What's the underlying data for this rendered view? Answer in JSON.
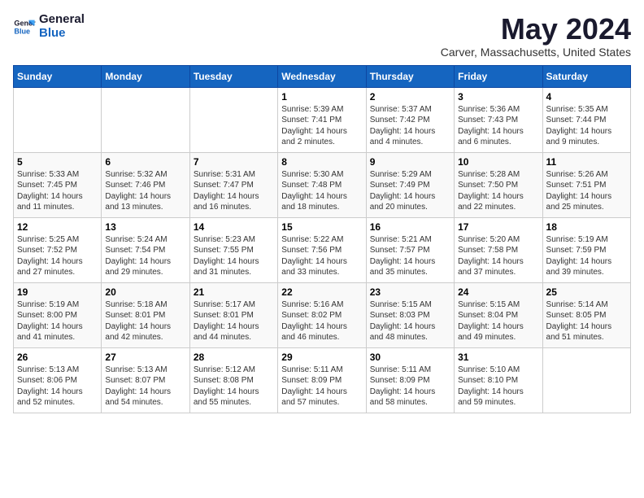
{
  "header": {
    "logo_line1": "General",
    "logo_line2": "Blue",
    "month_title": "May 2024",
    "location": "Carver, Massachusetts, United States"
  },
  "days_of_week": [
    "Sunday",
    "Monday",
    "Tuesday",
    "Wednesday",
    "Thursday",
    "Friday",
    "Saturday"
  ],
  "weeks": [
    [
      {
        "day": "",
        "info": ""
      },
      {
        "day": "",
        "info": ""
      },
      {
        "day": "",
        "info": ""
      },
      {
        "day": "1",
        "info": "Sunrise: 5:39 AM\nSunset: 7:41 PM\nDaylight: 14 hours\nand 2 minutes."
      },
      {
        "day": "2",
        "info": "Sunrise: 5:37 AM\nSunset: 7:42 PM\nDaylight: 14 hours\nand 4 minutes."
      },
      {
        "day": "3",
        "info": "Sunrise: 5:36 AM\nSunset: 7:43 PM\nDaylight: 14 hours\nand 6 minutes."
      },
      {
        "day": "4",
        "info": "Sunrise: 5:35 AM\nSunset: 7:44 PM\nDaylight: 14 hours\nand 9 minutes."
      }
    ],
    [
      {
        "day": "5",
        "info": "Sunrise: 5:33 AM\nSunset: 7:45 PM\nDaylight: 14 hours\nand 11 minutes."
      },
      {
        "day": "6",
        "info": "Sunrise: 5:32 AM\nSunset: 7:46 PM\nDaylight: 14 hours\nand 13 minutes."
      },
      {
        "day": "7",
        "info": "Sunrise: 5:31 AM\nSunset: 7:47 PM\nDaylight: 14 hours\nand 16 minutes."
      },
      {
        "day": "8",
        "info": "Sunrise: 5:30 AM\nSunset: 7:48 PM\nDaylight: 14 hours\nand 18 minutes."
      },
      {
        "day": "9",
        "info": "Sunrise: 5:29 AM\nSunset: 7:49 PM\nDaylight: 14 hours\nand 20 minutes."
      },
      {
        "day": "10",
        "info": "Sunrise: 5:28 AM\nSunset: 7:50 PM\nDaylight: 14 hours\nand 22 minutes."
      },
      {
        "day": "11",
        "info": "Sunrise: 5:26 AM\nSunset: 7:51 PM\nDaylight: 14 hours\nand 25 minutes."
      }
    ],
    [
      {
        "day": "12",
        "info": "Sunrise: 5:25 AM\nSunset: 7:52 PM\nDaylight: 14 hours\nand 27 minutes."
      },
      {
        "day": "13",
        "info": "Sunrise: 5:24 AM\nSunset: 7:54 PM\nDaylight: 14 hours\nand 29 minutes."
      },
      {
        "day": "14",
        "info": "Sunrise: 5:23 AM\nSunset: 7:55 PM\nDaylight: 14 hours\nand 31 minutes."
      },
      {
        "day": "15",
        "info": "Sunrise: 5:22 AM\nSunset: 7:56 PM\nDaylight: 14 hours\nand 33 minutes."
      },
      {
        "day": "16",
        "info": "Sunrise: 5:21 AM\nSunset: 7:57 PM\nDaylight: 14 hours\nand 35 minutes."
      },
      {
        "day": "17",
        "info": "Sunrise: 5:20 AM\nSunset: 7:58 PM\nDaylight: 14 hours\nand 37 minutes."
      },
      {
        "day": "18",
        "info": "Sunrise: 5:19 AM\nSunset: 7:59 PM\nDaylight: 14 hours\nand 39 minutes."
      }
    ],
    [
      {
        "day": "19",
        "info": "Sunrise: 5:19 AM\nSunset: 8:00 PM\nDaylight: 14 hours\nand 41 minutes."
      },
      {
        "day": "20",
        "info": "Sunrise: 5:18 AM\nSunset: 8:01 PM\nDaylight: 14 hours\nand 42 minutes."
      },
      {
        "day": "21",
        "info": "Sunrise: 5:17 AM\nSunset: 8:01 PM\nDaylight: 14 hours\nand 44 minutes."
      },
      {
        "day": "22",
        "info": "Sunrise: 5:16 AM\nSunset: 8:02 PM\nDaylight: 14 hours\nand 46 minutes."
      },
      {
        "day": "23",
        "info": "Sunrise: 5:15 AM\nSunset: 8:03 PM\nDaylight: 14 hours\nand 48 minutes."
      },
      {
        "day": "24",
        "info": "Sunrise: 5:15 AM\nSunset: 8:04 PM\nDaylight: 14 hours\nand 49 minutes."
      },
      {
        "day": "25",
        "info": "Sunrise: 5:14 AM\nSunset: 8:05 PM\nDaylight: 14 hours\nand 51 minutes."
      }
    ],
    [
      {
        "day": "26",
        "info": "Sunrise: 5:13 AM\nSunset: 8:06 PM\nDaylight: 14 hours\nand 52 minutes."
      },
      {
        "day": "27",
        "info": "Sunrise: 5:13 AM\nSunset: 8:07 PM\nDaylight: 14 hours\nand 54 minutes."
      },
      {
        "day": "28",
        "info": "Sunrise: 5:12 AM\nSunset: 8:08 PM\nDaylight: 14 hours\nand 55 minutes."
      },
      {
        "day": "29",
        "info": "Sunrise: 5:11 AM\nSunset: 8:09 PM\nDaylight: 14 hours\nand 57 minutes."
      },
      {
        "day": "30",
        "info": "Sunrise: 5:11 AM\nSunset: 8:09 PM\nDaylight: 14 hours\nand 58 minutes."
      },
      {
        "day": "31",
        "info": "Sunrise: 5:10 AM\nSunset: 8:10 PM\nDaylight: 14 hours\nand 59 minutes."
      },
      {
        "day": "",
        "info": ""
      }
    ]
  ]
}
